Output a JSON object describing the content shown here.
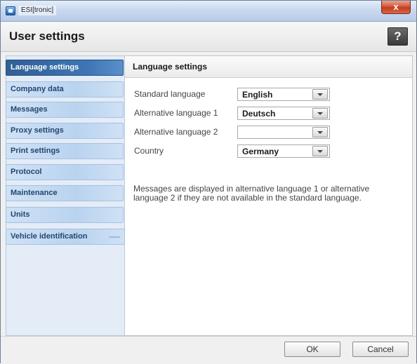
{
  "window": {
    "title": "ESI[tronic]",
    "close_label": "x"
  },
  "header": {
    "title": "User settings",
    "help_label": "?"
  },
  "sidebar": {
    "items": [
      {
        "label": "Language settings",
        "active": true
      },
      {
        "label": "Company data"
      },
      {
        "label": "Messages"
      },
      {
        "label": "Proxy settings"
      },
      {
        "label": "Print settings"
      },
      {
        "label": "Protocol"
      },
      {
        "label": "Maintenance"
      },
      {
        "label": "Units"
      },
      {
        "label": "Vehicle identification"
      }
    ]
  },
  "content": {
    "section_title": "Language settings",
    "fields": [
      {
        "label": "Standard language",
        "value": "English"
      },
      {
        "label": "Alternative language 1",
        "value": "Deutsch"
      },
      {
        "label": "Alternative language 2",
        "value": ""
      },
      {
        "label": "Country",
        "value": "Germany"
      }
    ],
    "info": "Messages are displayed in alternative language 1 or alternative language 2 if they are not available in the standard language."
  },
  "footer": {
    "ok_label": "OK",
    "cancel_label": "Cancel"
  },
  "colors": {
    "accent": "#3e76b5",
    "nav_bg": "#b9d3ef",
    "close": "#c43c1d"
  },
  "icons": {
    "app": "app-icon",
    "help": "help-icon",
    "dropdown": "chevron-down-icon",
    "close": "close-icon"
  }
}
